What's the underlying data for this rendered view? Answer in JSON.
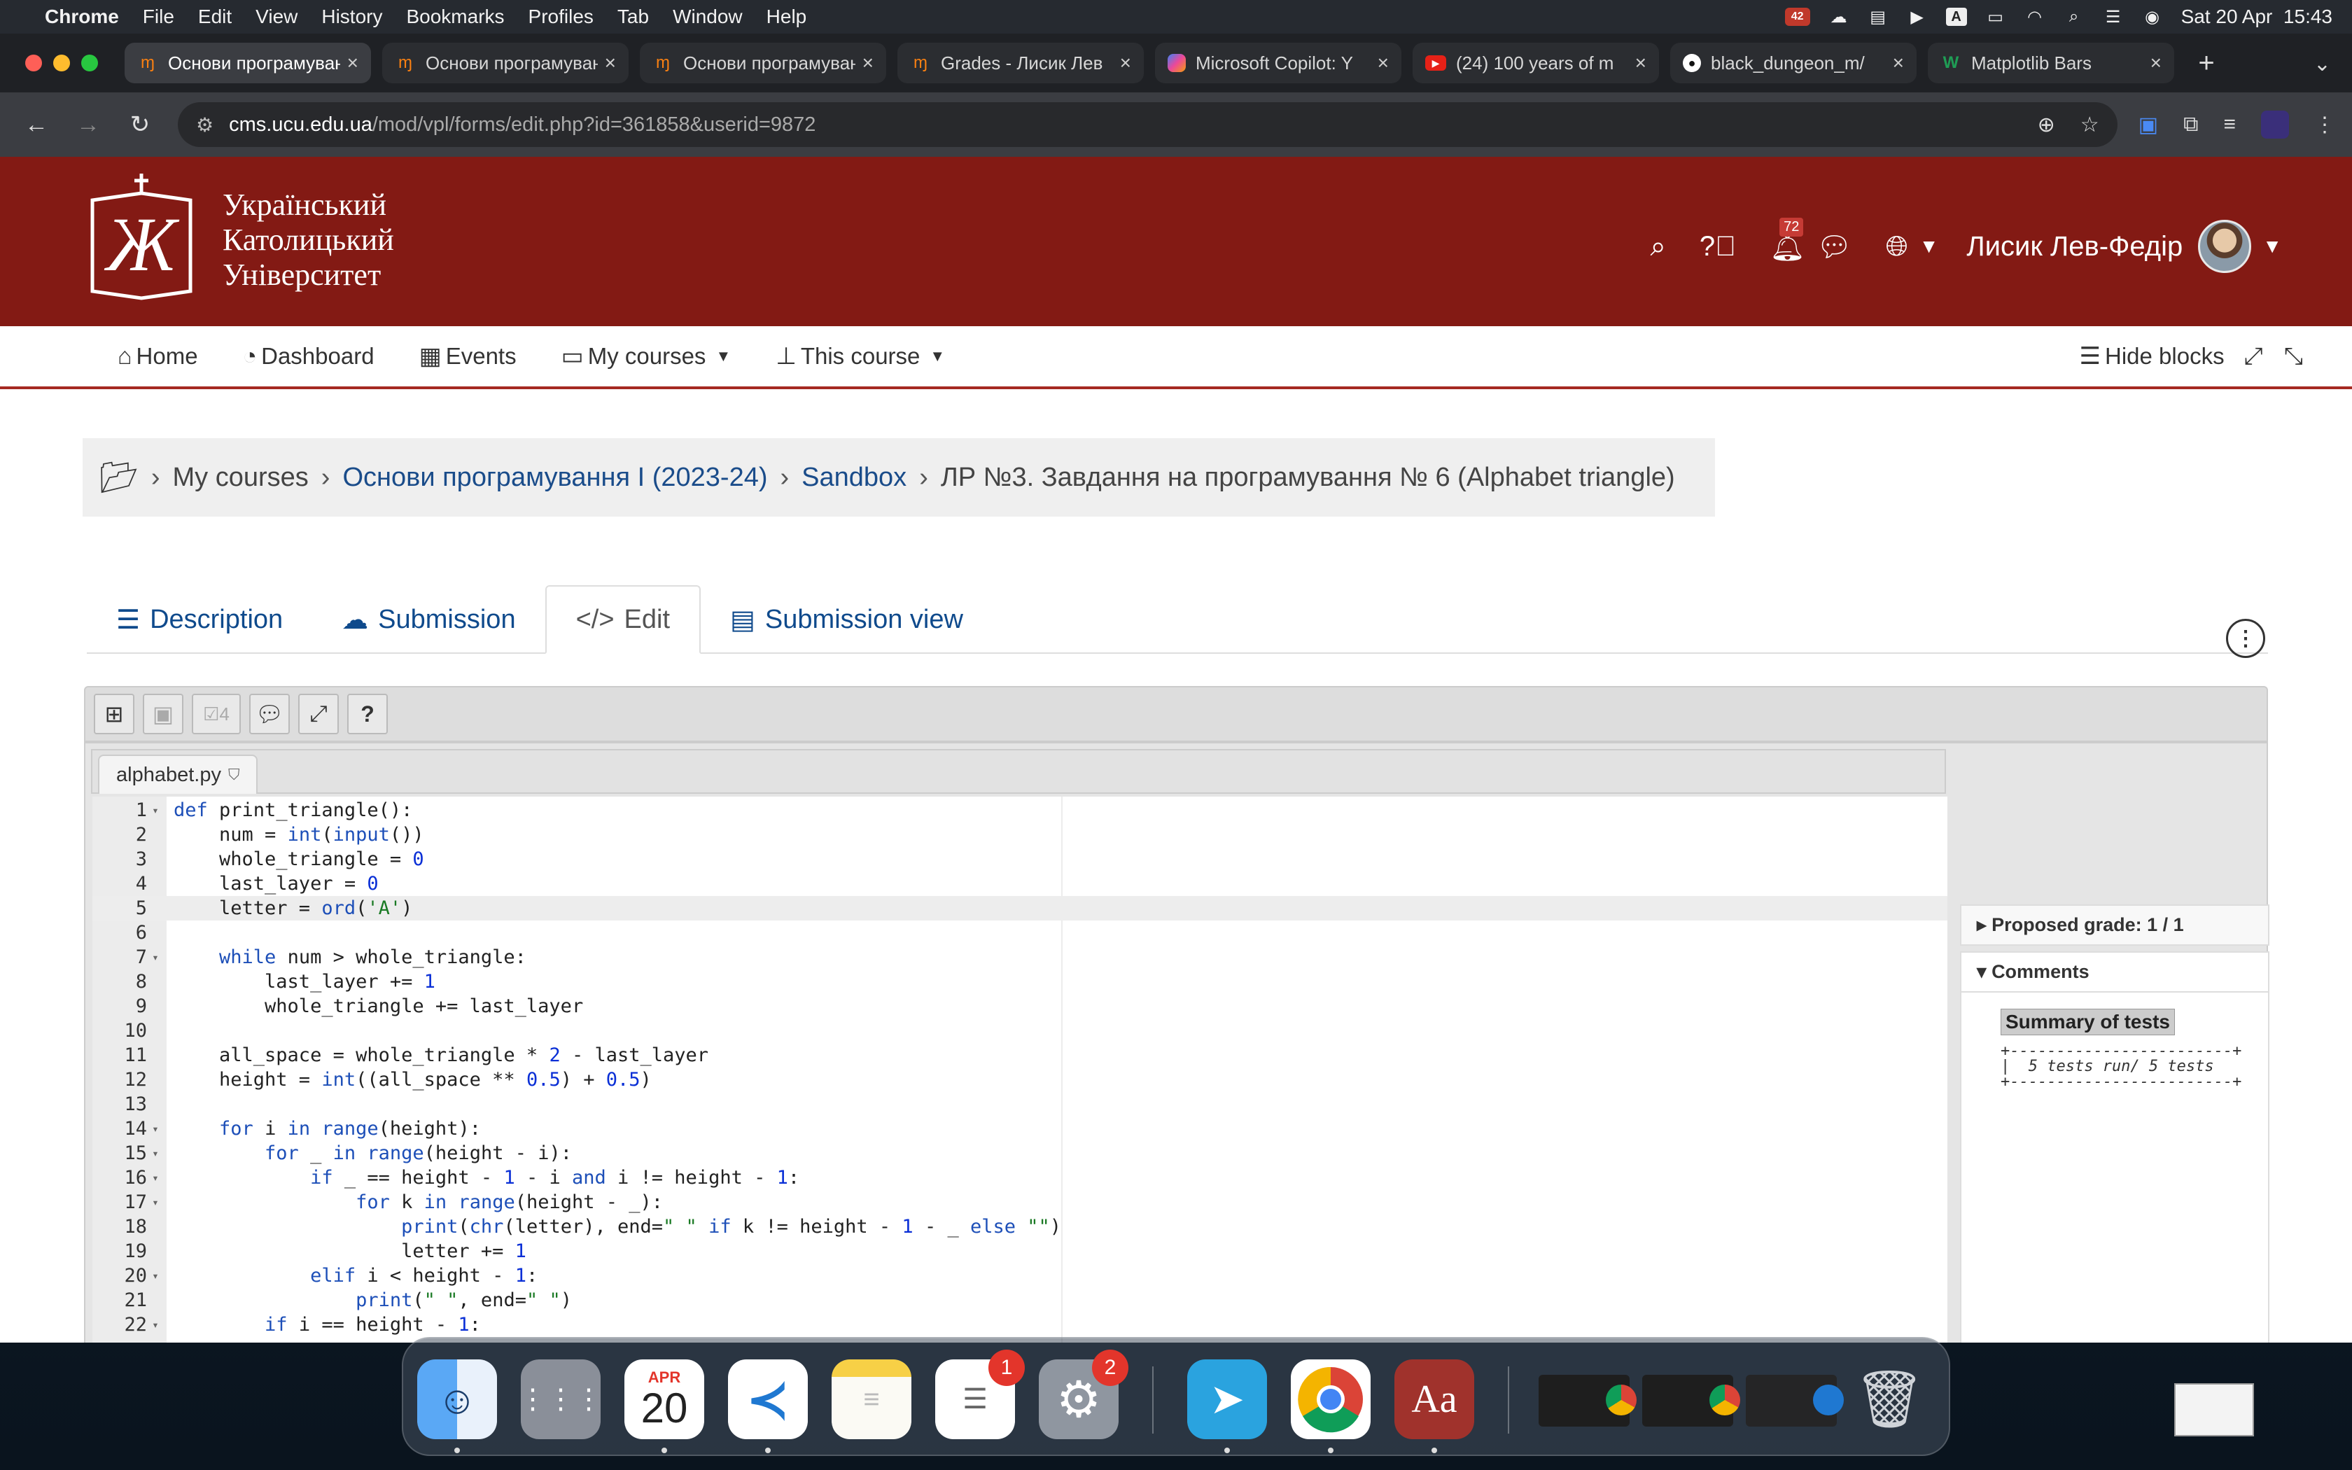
{
  "menubar": {
    "app": "Chrome",
    "items": [
      "File",
      "Edit",
      "View",
      "History",
      "Bookmarks",
      "Profiles",
      "Tab",
      "Window",
      "Help"
    ],
    "datetime": "Sat 20 Apr  15:43",
    "status_badge": "42"
  },
  "browser": {
    "tabs": [
      {
        "title": "Основи програмування",
        "icon": "moodle-icon",
        "active": true
      },
      {
        "title": "Основи програмування",
        "icon": "moodle-icon",
        "active": false
      },
      {
        "title": "Основи програмування",
        "icon": "moodle-icon",
        "active": false
      },
      {
        "title": "Grades - Лисик Лев",
        "icon": "moodle-icon",
        "active": false
      },
      {
        "title": "Microsoft Copilot: Y",
        "icon": "copilot-icon",
        "active": false
      },
      {
        "title": "(24) 100 years of m",
        "icon": "youtube-icon",
        "active": false
      },
      {
        "title": "black_dungeon_m/",
        "icon": "github-icon",
        "active": false
      },
      {
        "title": "Matplotlib Bars",
        "icon": "w-icon",
        "active": false
      }
    ],
    "url_host": "cms.ucu.edu.ua",
    "url_path": "/mod/vpl/forms/edit.php?id=361858&userid=9872"
  },
  "site": {
    "logo_lines": [
      "Український",
      "Католицький",
      "Університет"
    ],
    "notifications_count": "72",
    "user_name": "Лисик Лев-Федір"
  },
  "nav": {
    "home": "Home",
    "dashboard": "Dashboard",
    "events": "Events",
    "my_courses": "My courses",
    "this_course": "This course",
    "hide_blocks": "Hide blocks"
  },
  "breadcrumb": {
    "my_courses": "My courses",
    "course": "Основи програмування І (2023-24)",
    "section": "Sandbox",
    "current": "ЛР №3. Завдання на програмування № 6 (Alphabet triangle)"
  },
  "page_tabs": {
    "description": "Description",
    "submission": "Submission",
    "edit": "Edit",
    "submission_view": "Submission view"
  },
  "toolbar": {
    "evaluate_count": "4"
  },
  "editor": {
    "filename": "alphabet.py",
    "lines": [
      {
        "n": "1",
        "fold": true
      },
      {
        "n": "2"
      },
      {
        "n": "3"
      },
      {
        "n": "4"
      },
      {
        "n": "5"
      },
      {
        "n": "6"
      },
      {
        "n": "7",
        "fold": true
      },
      {
        "n": "8"
      },
      {
        "n": "9"
      },
      {
        "n": "10"
      },
      {
        "n": "11"
      },
      {
        "n": "12"
      },
      {
        "n": "13"
      },
      {
        "n": "14",
        "fold": true
      },
      {
        "n": "15",
        "fold": true
      },
      {
        "n": "16",
        "fold": true
      },
      {
        "n": "17",
        "fold": true
      },
      {
        "n": "18"
      },
      {
        "n": "19"
      },
      {
        "n": "20",
        "fold": true
      },
      {
        "n": "21"
      },
      {
        "n": "22",
        "fold": true
      }
    ],
    "code": [
      "def print_triangle():",
      "    num = int(input())",
      "    whole_triangle = 0",
      "    last_layer = 0",
      "    letter = ord('A')",
      "",
      "    while num > whole_triangle:",
      "        last_layer += 1",
      "        whole_triangle += last_layer",
      "",
      "    all_space = whole_triangle * 2 - last_layer",
      "    height = int((all_space ** 0.5) + 0.5)",
      "",
      "    for i in range(height):",
      "        for _ in range(height - i):",
      "            if _ == height - 1 - i and i != height - 1:",
      "                for k in range(height - _):",
      "                    print(chr(letter), end=\" \" if k != height - 1 - _ else \"\")",
      "                    letter += 1",
      "            elif i < height - 1:",
      "                print(\" \", end=\" \")",
      "        if i == height - 1:"
    ]
  },
  "sidebar": {
    "proposed_grade": "Proposed grade: 1 / 1",
    "comments": "Comments",
    "summary_title": "Summary of tests",
    "summary_lines": [
      "+------------------------+",
      "|  5 tests run/ 5 tests",
      "+------------------------+"
    ]
  },
  "dock": {
    "calendar_month": "APR",
    "calendar_day": "20",
    "reminders_badge": "1",
    "settings_badge": "2"
  },
  "colors": {
    "brand_red": "#831a14",
    "link_blue": "#1a4c8a"
  }
}
